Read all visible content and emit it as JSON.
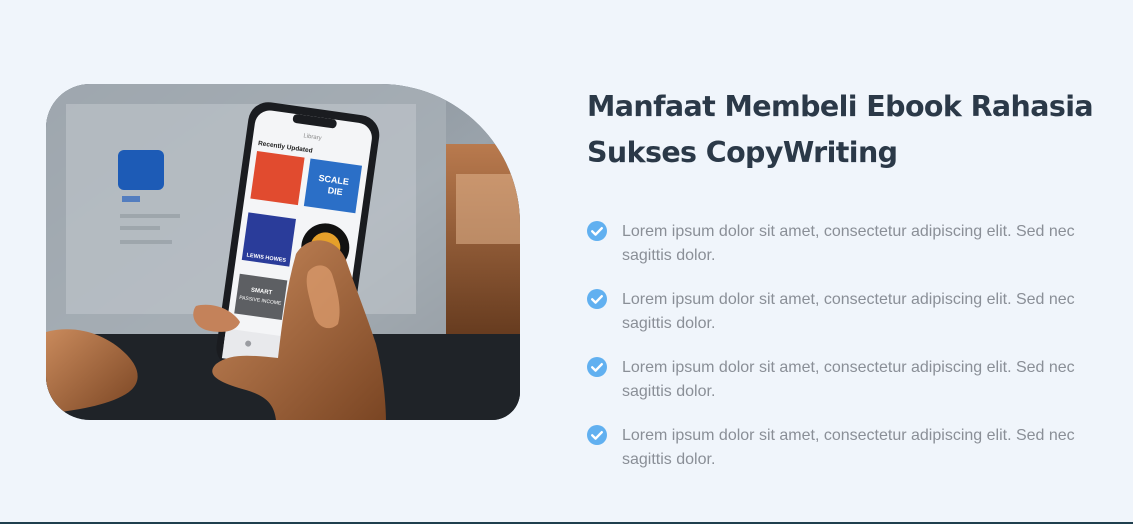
{
  "section": {
    "heading": "Manfaat Membeli Ebook Rahasia Sukses CopyWriting",
    "image": {
      "description_icon": "phone-ebook-photo",
      "phone_screen": {
        "library_label": "Library",
        "section_label": "Recently Updated",
        "covers": [
          "SCALE DIE",
          "LEWIS HOWES",
          "SMART PASSIVE INCOME"
        ]
      }
    },
    "benefits": [
      {
        "icon": "check-circle-icon",
        "text": "Lorem ipsum dolor sit amet, consectetur adipiscing elit. Sed nec sagittis dolor."
      },
      {
        "icon": "check-circle-icon",
        "text": "Lorem ipsum dolor sit amet, consectetur adipiscing elit. Sed nec sagittis dolor."
      },
      {
        "icon": "check-circle-icon",
        "text": "Lorem ipsum dolor sit amet, consectetur adipiscing elit. Sed nec sagittis dolor."
      },
      {
        "icon": "check-circle-icon",
        "text": "Lorem ipsum dolor sit amet, consectetur adipiscing elit. Sed nec sagittis dolor."
      }
    ]
  },
  "colors": {
    "background": "#f0f5fb",
    "heading": "#2b3948",
    "body_text": "#8a8f97",
    "check_icon": "#61b0f0",
    "bottom_border": "#1f3f4e"
  }
}
